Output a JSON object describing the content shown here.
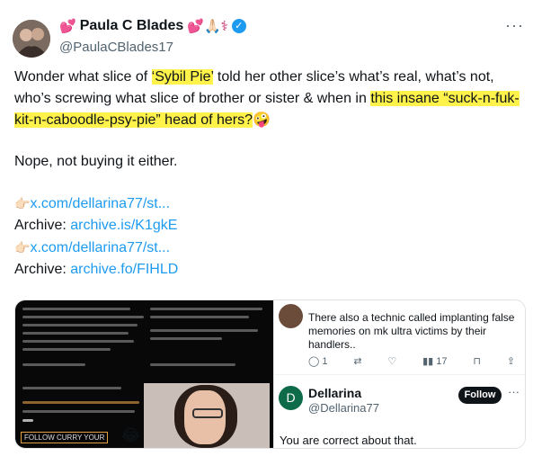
{
  "tweet": {
    "display_name": "Paula C Blades",
    "name_emojis_left": "💕",
    "name_emojis_right": "💕🙏🏻⚕",
    "handle": "@PaulaCBlades17",
    "more_label": "···",
    "text_part1": "Wonder what slice of ",
    "highlight1": "‘Sybil Pie’",
    "text_part2": " told her other slice’s what’s real, what’s not, who’s screwing what slice of brother or sister & when in ",
    "highlight2": "this insane “suck-n-fuk-kit-n-caboodle-psy-pie” head of hers?",
    "emoji_end": "🤪",
    "line2": "Nope, not buying it either.",
    "link1": "x.com/dellarina77/st...",
    "archive_label1": "Archive: ",
    "archive_link1": "archive.is/K1gkE",
    "link2": "x.com/dellarina77/st...",
    "archive_label2": "Archive: ",
    "archive_link2": "archive.fo/FIHLD",
    "hand_icon": "👉🏻"
  },
  "media": {
    "right": {
      "top_reply_text": "There also a technic called implanting false memories on mk ultra victims by their handlers..",
      "actions": [
        "1",
        "",
        "",
        "17",
        "",
        ""
      ],
      "reply_initial": "D",
      "reply_name": "Dellarina",
      "reply_handle": "@Dellarina77",
      "follow_label": "Follow",
      "more_label": "···",
      "reply_body": "You are correct about that."
    },
    "left": {
      "gif_emoji": "😂",
      "follow_tag": "FOLLOW CURRY YOUR"
    }
  },
  "colors": {
    "link": "#1d9bf0",
    "highlight": "#fff24a",
    "verified": "#1d9bf0"
  }
}
